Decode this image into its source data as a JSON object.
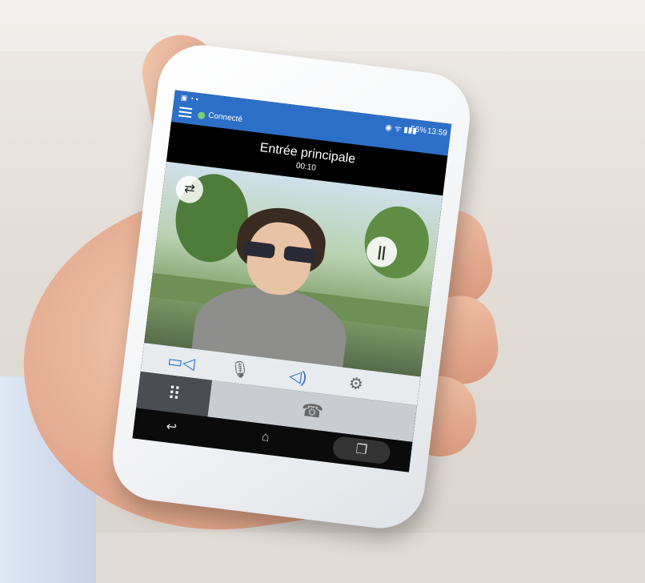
{
  "status_bar": {
    "top_icons": "▣ ◔ ▪",
    "connection_label": "Connecté",
    "connection_color": "#7bd16f",
    "system_icons": "◉ ᯤ ▮▮▮",
    "battery": "56%",
    "time": "13:59",
    "bar_color": "#2c6fc8"
  },
  "call": {
    "title": "Entrée principale",
    "timer": "00:10"
  },
  "video": {
    "camera_switch_icon": "⇄",
    "pause_icon": "||"
  },
  "controls": {
    "video_icon": "▭◁",
    "mic_muted_icon": "🎙",
    "speaker_icon": "◁)",
    "settings_icon": "⚙",
    "keypad_icon": "⠿",
    "hangup_icon": "☎"
  },
  "android_nav": {
    "back_icon": "↩",
    "home_icon": "⌂",
    "recents_icon": "❐"
  }
}
